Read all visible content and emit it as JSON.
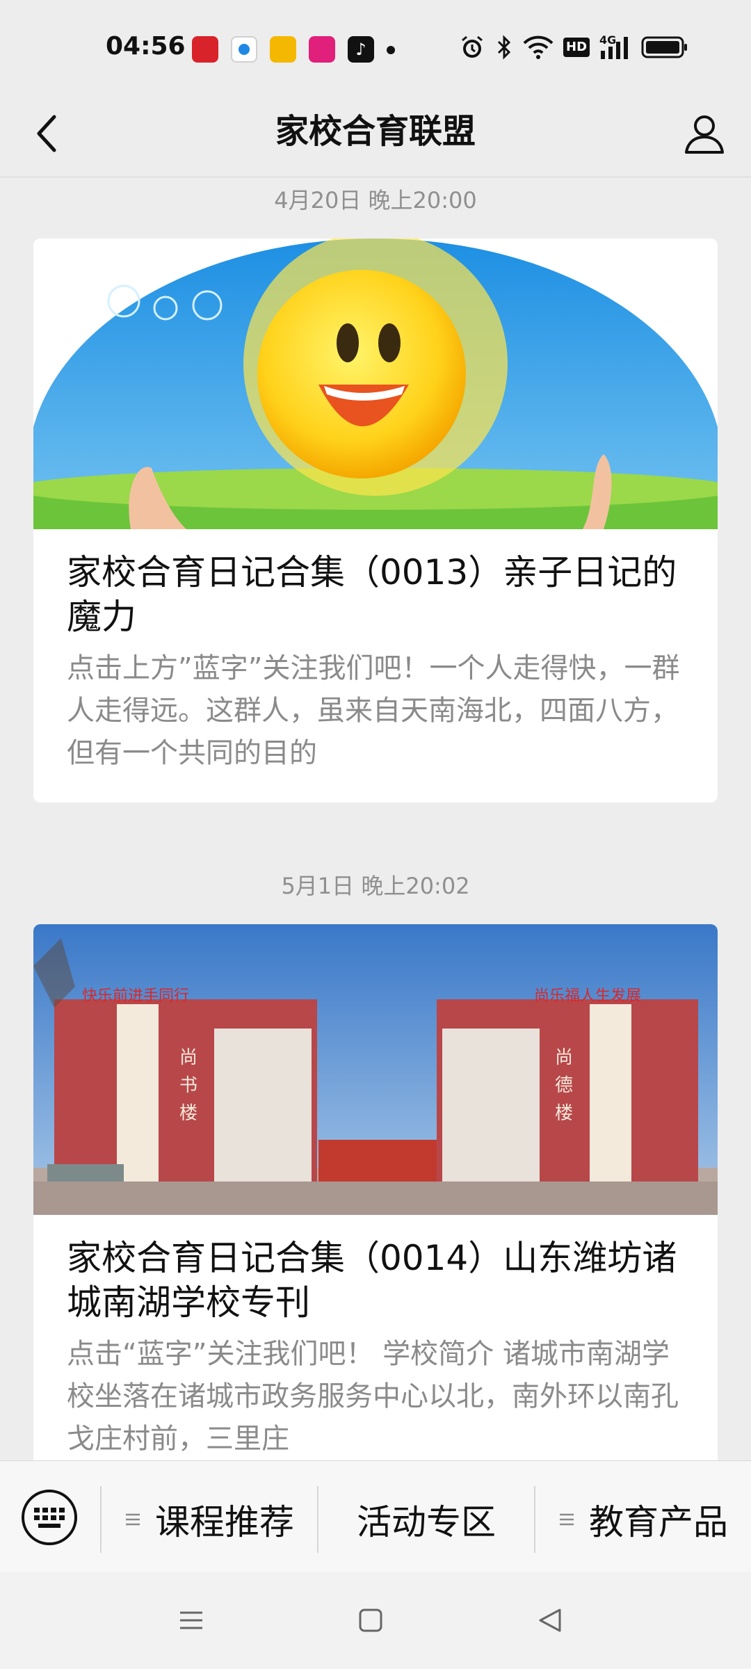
{
  "status_bar": {
    "time": "04:56",
    "icons": [
      "news-app-icon",
      "browser-app-icon",
      "reader-app-icon",
      "video-app-icon",
      "tiktok-app-icon",
      "alarm-icon",
      "bluetooth-icon",
      "wifi-icon",
      "hd-icon",
      "signal-4g-icon",
      "battery-icon"
    ],
    "hd_label": "HD",
    "network_label": "4G"
  },
  "nav": {
    "title": "家校合育联盟"
  },
  "feed": [
    {
      "timestamp": "4月20日 晚上20:00",
      "title": "家校合育日记合集（0013）亲子日记的魔力",
      "desc": "点击上方”蓝字”关注我们吧！一个人走得快，一群人走得远。这群人，虽来自天南海北，四面八方，但有一个共同的目的"
    },
    {
      "timestamp": "5月1日 晚上20:02",
      "title": "家校合育日记合集（0014）山东潍坊诸城南湖学校专刊",
      "desc": "点击“蓝字”关注我们吧！ 学校简介 诸城市南湖学校坐落在诸城市政务服务中心以北，南外环以南孔戈庄村前，三里庄"
    }
  ],
  "bottom_menu": {
    "items": [
      "课程推荐",
      "活动专区",
      "教育产品"
    ]
  },
  "colors": {
    "background": "#ededed",
    "card": "#ffffff",
    "muted_text": "#8a8a8a"
  }
}
